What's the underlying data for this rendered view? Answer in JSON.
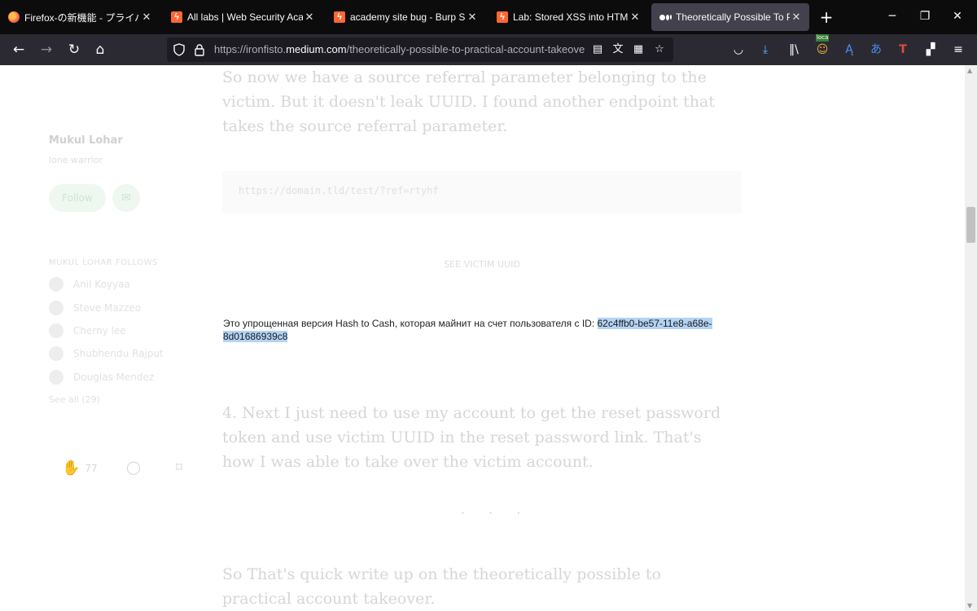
{
  "browser": {
    "tabs": [
      {
        "title": "Firefox-の新機能 - プライバシー保",
        "icon": "firefox-icon",
        "active": false
      },
      {
        "title": "All labs | Web Security Academy",
        "icon": "portswigger-icon",
        "active": false
      },
      {
        "title": "academy site bug - Burp Suite",
        "icon": "portswigger-icon",
        "active": false
      },
      {
        "title": "Lab: Stored XSS into HTML co",
        "icon": "portswigger-icon",
        "active": false
      },
      {
        "title": "Theoretically Possible To Practical",
        "icon": "medium-icon",
        "active": true
      }
    ],
    "close_glyph": "✕",
    "new_tab_glyph": "+",
    "url": {
      "prefix": "https://ironfisto.",
      "host": "medium.com",
      "path": "/theoretically-possible-to-practical-account-takeover"
    },
    "extension_badge": "loca"
  },
  "sidebar": {
    "author_name": "Mukul Lohar",
    "author_bio": "lone warrior",
    "follow_label": "Follow",
    "follows_heading": "MUKUL LOHAR FOLLOWS",
    "follows": [
      "Anil Koyyaa",
      "Steve Mazzeo",
      "Cherny lee",
      "Shubhendu Rajput",
      "Douglas Mendez"
    ],
    "see_all": "See all (29)",
    "clap_count": "77"
  },
  "article": {
    "para1": "So now we have a source referral parameter belonging to the victim. But it doesn't leak UUID. I found another endpoint that takes the source referral parameter.",
    "code": "https://domain.tld/test/?ref=rtyhf",
    "caption": "SEE VICTIM UUID",
    "selected_prefix": "Это упрощенная версия Hash to Cash, которая майнит на счет пользователя с ID: ",
    "selected_id": "62c4ffb0-be57-11e8-a68e-8d01686939c8",
    "para2": "4. Next I just need to use my account to get the reset password token and use victim UUID in the reset password link. That's how I was able to take over the victim account.",
    "divider": "· · ·",
    "para3": "So That's quick write up on the theoretically possible to practical account takeover."
  }
}
